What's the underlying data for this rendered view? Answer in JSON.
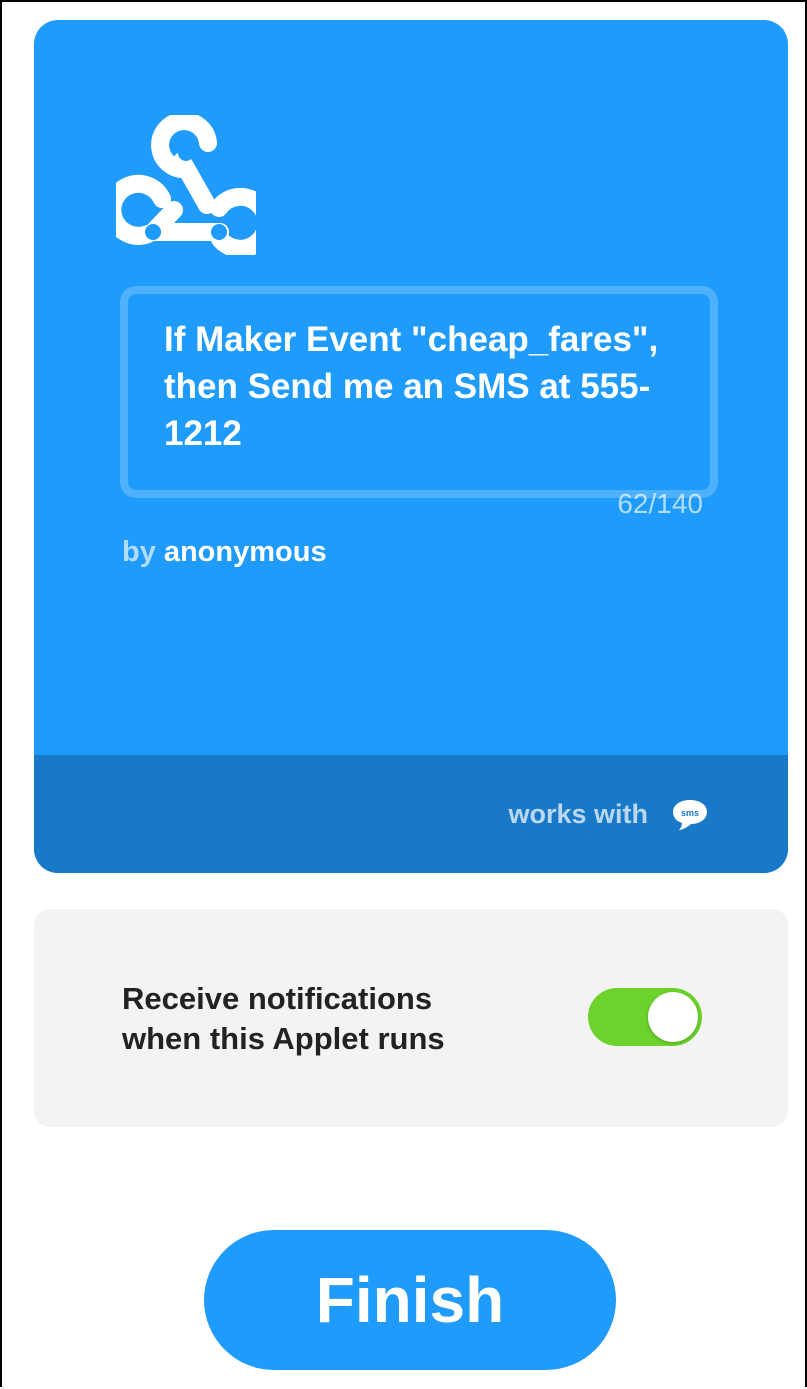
{
  "applet": {
    "title": "If Maker Event \"cheap_fares\", then Send me an SMS at 555-1212",
    "char_count": "62/140",
    "by_label": "by",
    "author": "anonymous",
    "service_icon": "webhook-icon",
    "works_with_label": "works with",
    "works_with_icon": "sms-icon",
    "works_with_icon_text": "sms",
    "color": "#1e9bfb",
    "footer_color": "#1879c8"
  },
  "notifications": {
    "label": "Receive notifications when this Applet runs",
    "enabled": true,
    "toggle_color": "#6bd32b"
  },
  "finish_button": {
    "label": "Finish"
  }
}
